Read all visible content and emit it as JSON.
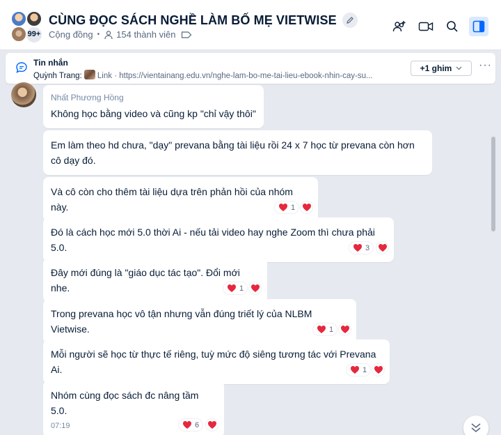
{
  "header": {
    "title": "CÙNG ĐỌC SÁCH NGHỀ LÀM BỐ MẸ VIETWISE",
    "group_type": "Cộng đồng",
    "member_count": "154 thành viên",
    "avatar_overflow": "99+"
  },
  "pinned": {
    "label": "Tin nhắn",
    "sender": "Quỳnh Trang:",
    "link_label": "Link",
    "url": "· https://vientainang.edu.vn/nghe-lam-bo-me-tai-lieu-ebook-nhin-cay-su...",
    "more_button": "+1 ghim"
  },
  "messages": [
    {
      "sender": "Nhất Phương Hồng",
      "text": "Không học bằng video và cũng kp \"chỉ vậy thôi\""
    },
    {
      "text": "Em làm theo hd chưa, \"dạy\" prevana bằng tài liệu rồi 24 x 7 học từ prevana còn hơn cô dạy đó."
    },
    {
      "text": "Và cô còn cho thêm tài liệu dựa trên phản hồi của nhóm này.",
      "reaction_count": "1"
    },
    {
      "text": "Đó là cách học mới 5.0 thời Ai - nếu tải video hay nghe Zoom thì chưa phải 5.0.",
      "reaction_count": "3"
    },
    {
      "text": "Đây mới đúng là \"giáo dục tác tạo\". Đổi mới nhe.",
      "reaction_count": "1"
    },
    {
      "text": "Trong prevana học vô tận nhưng vẫn đúng triết lý của NLBM Vietwise.",
      "reaction_count": "1"
    },
    {
      "text": "Mỗi người sẽ học từ thực tế riêng, tuỳ mức độ siêng tương tác với Prevana Ai.",
      "reaction_count": "1"
    },
    {
      "text": "Nhóm cùng đọc sách đc nâng tầm 5.0.",
      "time": "07:19",
      "reaction_count": "6"
    }
  ],
  "colors": {
    "heart": "#e5283e",
    "accent": "#0068ff",
    "background": "#e6eaf0"
  }
}
